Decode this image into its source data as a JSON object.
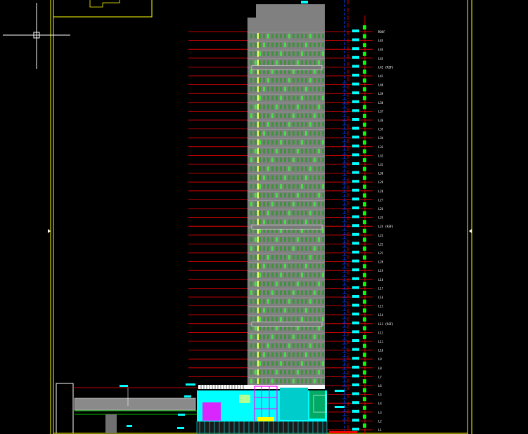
{
  "drawing": {
    "floor_labels": [
      "ROOF",
      "L45",
      "L44",
      "L43",
      "L42 (REF)",
      "L41",
      "L40",
      "L39",
      "L38",
      "L37",
      "L36",
      "L35",
      "L34",
      "L33",
      "L32",
      "L31",
      "L30",
      "L29",
      "L28",
      "L27",
      "L26",
      "L25",
      "L24 (REF)",
      "L23",
      "L22",
      "L21",
      "L20",
      "L19",
      "L18",
      "L17",
      "L16",
      "L15",
      "L14",
      "L13 (REF)",
      "L12",
      "L11",
      "L10",
      "L9",
      "L8",
      "L7",
      "L6",
      "L5",
      "L4",
      "L3",
      "L2",
      "L1"
    ],
    "colors": {
      "background": "#000000",
      "border": "#ffff00",
      "level_lines": "#ff0000",
      "tower_fill": "#808080",
      "facade_green": "#00ff00",
      "podium_cyan": "#00ffff",
      "podium_magenta": "#ff00ff",
      "axis_blue": "#0044ff",
      "text_white": "#ffffff"
    },
    "icons": [
      "crosshair-cursor-icon",
      "section-marker-icon"
    ]
  }
}
